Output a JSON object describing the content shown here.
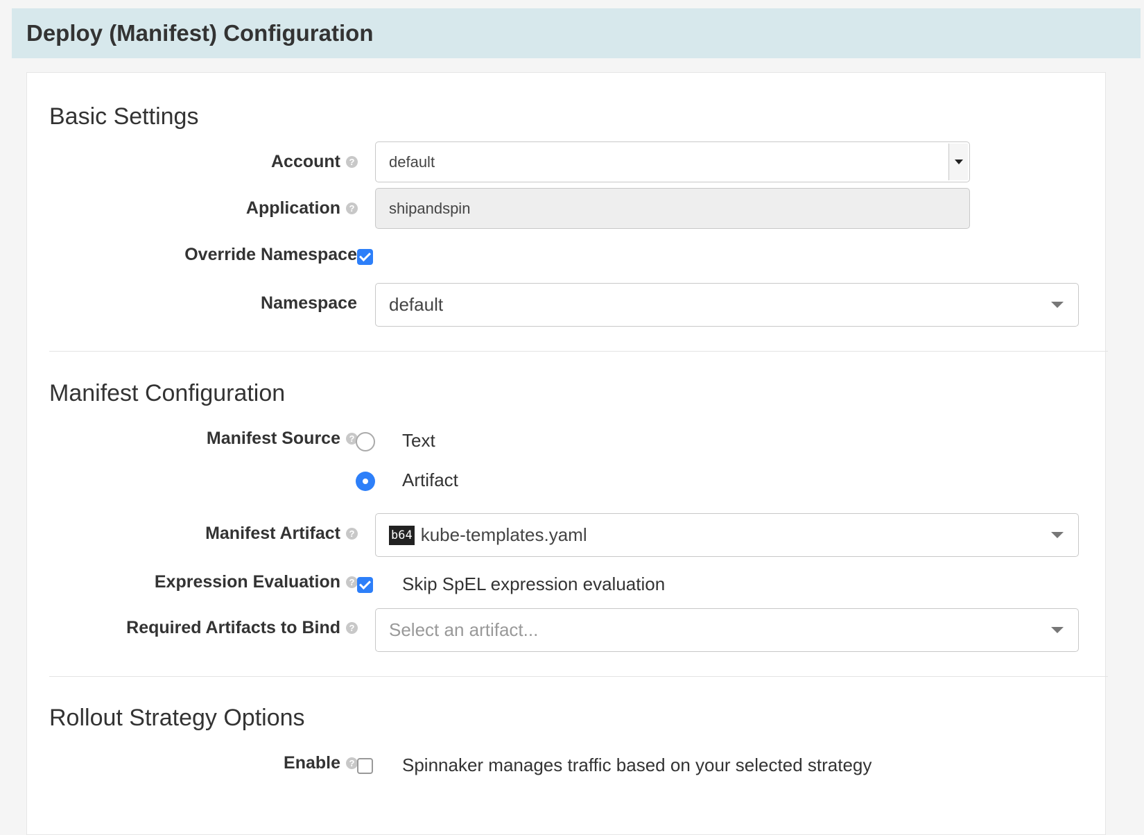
{
  "header": {
    "title": "Deploy (Manifest) Configuration"
  },
  "basic_settings": {
    "title": "Basic Settings",
    "account": {
      "label": "Account",
      "value": "default"
    },
    "application": {
      "label": "Application",
      "value": "shipandspin"
    },
    "override_namespace": {
      "label": "Override Namespace",
      "checked": true
    },
    "namespace": {
      "label": "Namespace",
      "value": "default"
    }
  },
  "manifest_configuration": {
    "title": "Manifest Configuration",
    "manifest_source": {
      "label": "Manifest Source",
      "options": [
        {
          "label": "Text",
          "selected": false
        },
        {
          "label": "Artifact",
          "selected": true
        }
      ]
    },
    "manifest_artifact": {
      "label": "Manifest Artifact",
      "badge": "b64",
      "value": "kube-templates.yaml"
    },
    "expression_evaluation": {
      "label": "Expression Evaluation",
      "checked": true,
      "option_label": "Skip SpEL expression evaluation"
    },
    "required_artifacts": {
      "label": "Required Artifacts to Bind",
      "placeholder": "Select an artifact..."
    }
  },
  "rollout_strategy": {
    "title": "Rollout Strategy Options",
    "enable": {
      "label": "Enable",
      "checked": false,
      "option_label": "Spinnaker manages traffic based on your selected strategy"
    }
  },
  "icons": {
    "help": "?"
  },
  "colors": {
    "accent": "#2d7ff9",
    "header_bg": "#d7e8ec"
  }
}
